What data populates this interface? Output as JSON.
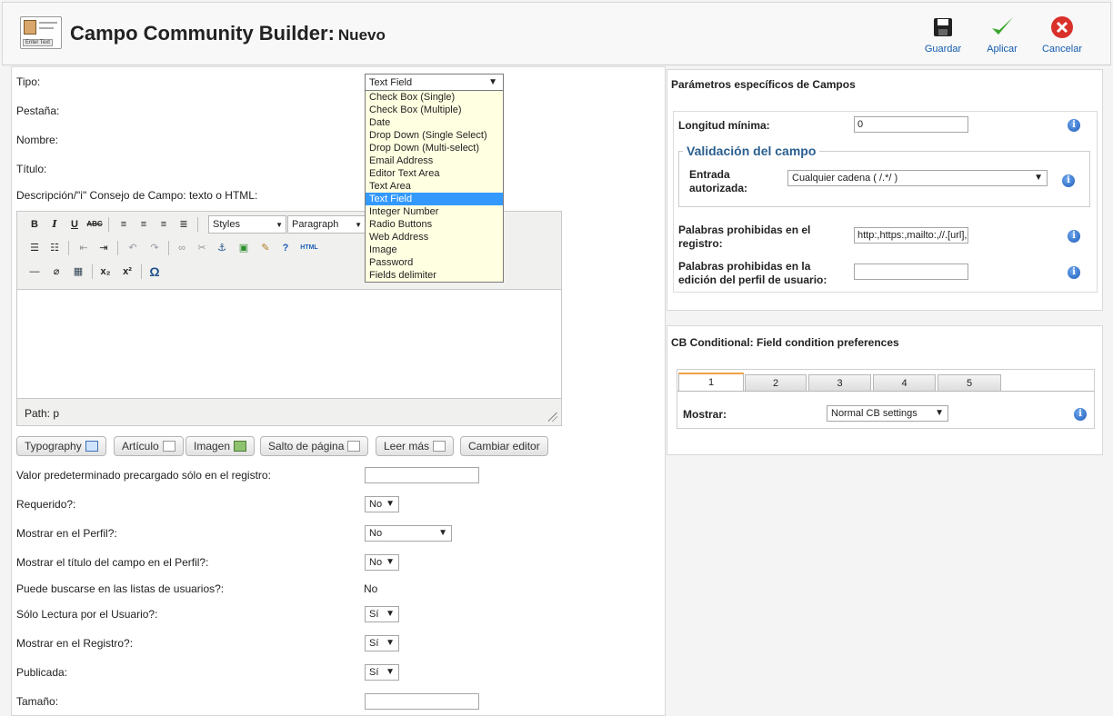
{
  "header": {
    "title": "Campo Community Builder:",
    "subtitle": "Nuevo",
    "icon_text": "Enter Text",
    "buttons": {
      "save": "Guardar",
      "apply": "Aplicar",
      "cancel": "Cancelar"
    }
  },
  "form": {
    "tipo_label": "Tipo:",
    "tipo_value": "Text Field",
    "tipo_options": [
      "Check Box (Single)",
      "Check Box (Multiple)",
      "Date",
      "Drop Down (Single Select)",
      "Drop Down (Multi-select)",
      "Email Address",
      "Editor Text Area",
      "Text Area",
      "Text Field",
      "Integer Number",
      "Radio Buttons",
      "Web Address",
      "Image",
      "Password",
      "Fields delimiter"
    ],
    "pestana_label": "Pestaña:",
    "nombre_label": "Nombre:",
    "titulo_label": "Título:",
    "descripcion_label": "Descripción/\"i\" Consejo de Campo: texto o HTML:",
    "editor": {
      "styles": "Styles",
      "paragraph": "Paragraph",
      "path": "Path: p",
      "html_btn": "HTML"
    },
    "editor_buttons": {
      "typography": "Typography",
      "articulo": "Artículo",
      "imagen": "Imagen",
      "salto": "Salto de página",
      "leer_mas": "Leer más",
      "cambiar": "Cambiar editor"
    },
    "valor_label": "Valor predeterminado precargado sólo en el registro:",
    "requerido_label": "Requerido?:",
    "requerido_value": "No",
    "perfil_label": "Mostrar en el Perfil?:",
    "perfil_value": "No",
    "titulo_perfil_label": "Mostrar el título del campo en el Perfil?:",
    "titulo_perfil_value": "No",
    "buscable_label": "Puede buscarse en las listas de usuarios?:",
    "buscable_value": "No",
    "lectura_label": "Sólo Lectura por el Usuario?:",
    "lectura_value": "Sí",
    "registro_label": "Mostrar en el Registro?:",
    "registro_value": "Sí",
    "publicada_label": "Publicada:",
    "publicada_value": "Sí",
    "tamano_label": "Tamaño:"
  },
  "params": {
    "title": "Parámetros específicos de Campos",
    "longitud_label": "Longitud mínima:",
    "longitud_value": "0",
    "validacion_legend": "Validación del campo",
    "entrada_label_1": "Entrada",
    "entrada_label_2": "autorizada:",
    "entrada_value": "Cualquier cadena ( /.*/ )",
    "prohibidas_reg_1": "Palabras prohibidas en el",
    "prohibidas_reg_2": "registro:",
    "prohibidas_reg_value": "http:,https:,mailto:,//.[url],<",
    "prohibidas_ed_1": "Palabras prohibidas en la",
    "prohibidas_ed_2": "edición del perfil de usuario:"
  },
  "conditional": {
    "title": "CB Conditional: Field condition preferences",
    "tabs": [
      "1",
      "2",
      "3",
      "4",
      "5"
    ],
    "mostrar_label": "Mostrar:",
    "mostrar_value": "Normal CB settings"
  },
  "colors": {
    "link_blue": "#135cae",
    "legend_blue": "#2a5f8f",
    "dropdown_bg": "#ffffe1",
    "selected_bg": "#3399ff"
  }
}
